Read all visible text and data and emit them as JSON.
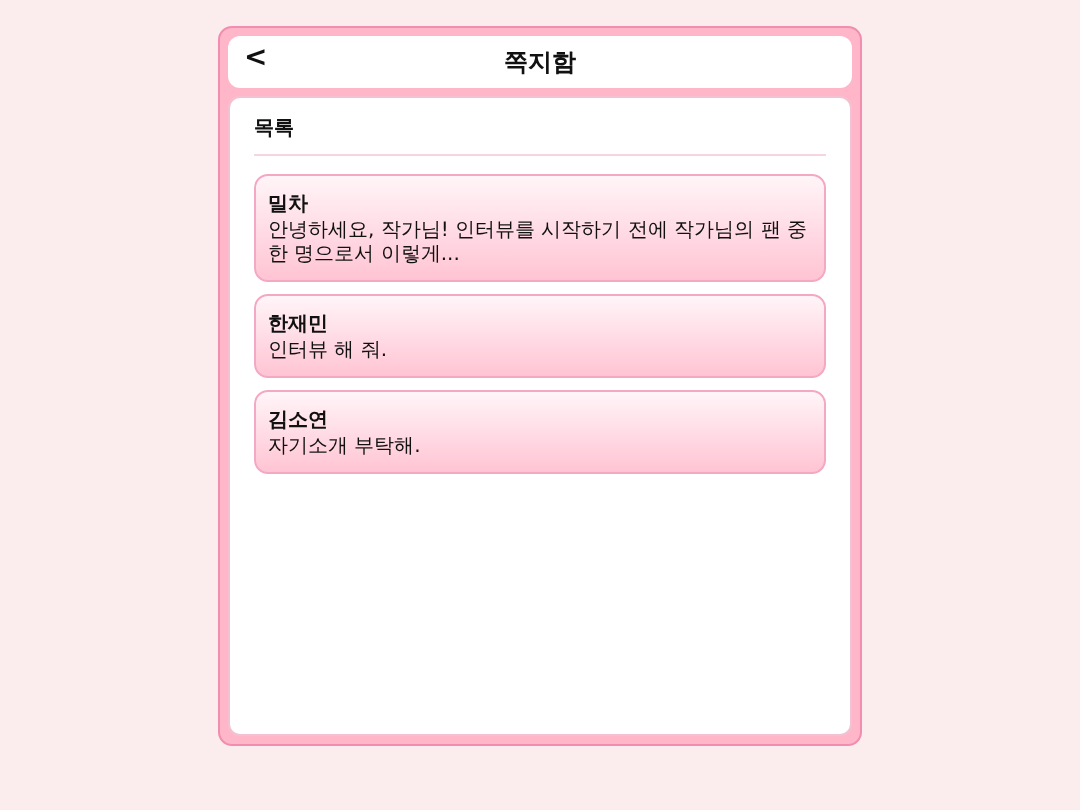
{
  "header": {
    "back_icon": "<",
    "title": "쪽지함"
  },
  "section": {
    "title": "목록"
  },
  "messages": [
    {
      "sender": "밀차",
      "preview": "안녕하세요, 작가님! 인터뷰를 시작하기 전에 작가님의 팬 중 한 명으로서 이렇게..."
    },
    {
      "sender": "한재민",
      "preview": "인터뷰 해 줘."
    },
    {
      "sender": "김소연",
      "preview": "자기소개 부탁해."
    }
  ]
}
